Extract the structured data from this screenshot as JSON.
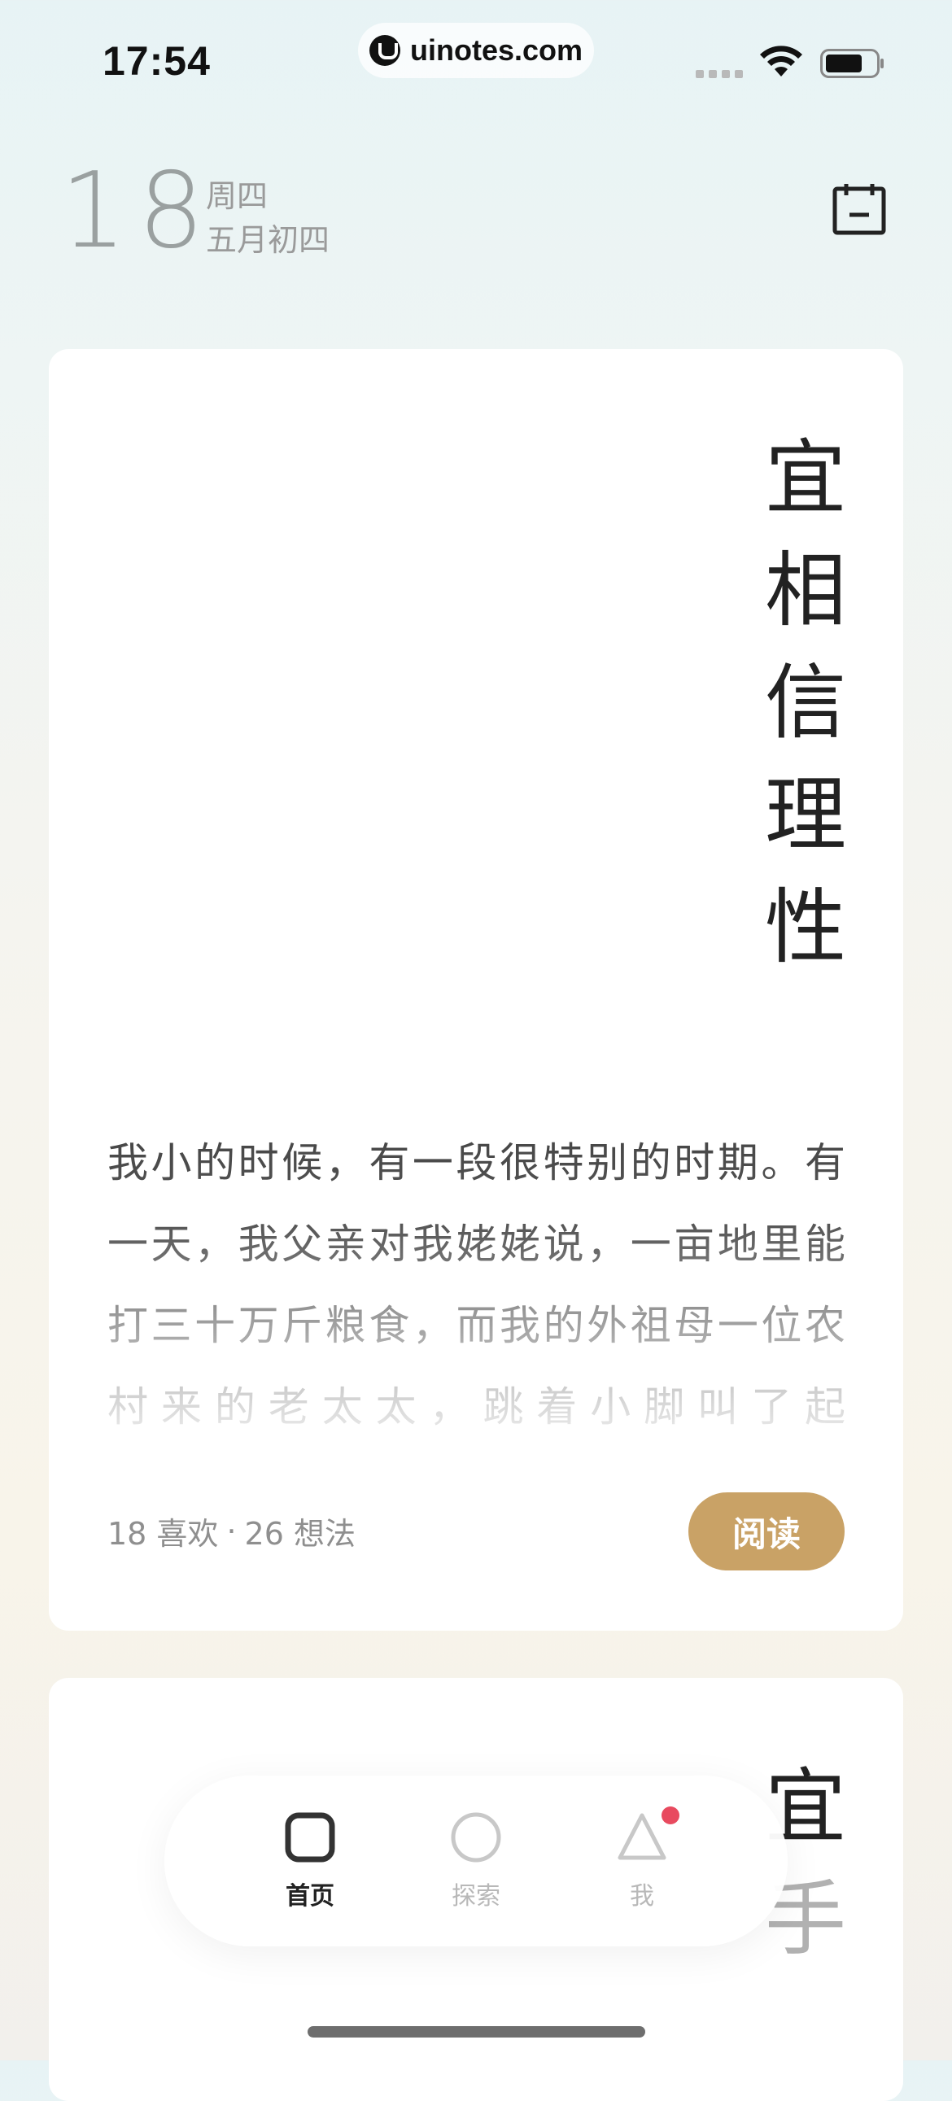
{
  "status_bar": {
    "time": "17:54",
    "url": "uinotes.com"
  },
  "date_header": {
    "day": "18",
    "weekday": "周四",
    "lunar_date": "五月初四"
  },
  "icons": {
    "calendar": "calendar-icon",
    "home": "square-icon",
    "explore": "circle-icon",
    "me": "triangle-icon"
  },
  "card": {
    "title_chars": [
      "宜",
      "相",
      "信",
      "理",
      "性"
    ],
    "excerpt": "我小的时候，有一段很特别的时期。有一天，我父亲对我姥姥说，一亩地里能打三十万斤粮食，而我的外祖母一位农村来的老太太，跳着小脚叫了起来：“杀了我我也不信！”她还说",
    "likes": "18 喜欢",
    "separator": "·",
    "thoughts": "26 想法",
    "read_label": "阅读"
  },
  "card_2": {
    "title_chars": [
      "宜",
      "手"
    ]
  },
  "bottom_nav": {
    "items": [
      {
        "label": "首页",
        "active": true
      },
      {
        "label": "探索",
        "active": false
      },
      {
        "label": "我",
        "active": false,
        "badge": true
      }
    ]
  },
  "colors": {
    "accent": "#c9a266",
    "badge": "#e84a5f"
  }
}
